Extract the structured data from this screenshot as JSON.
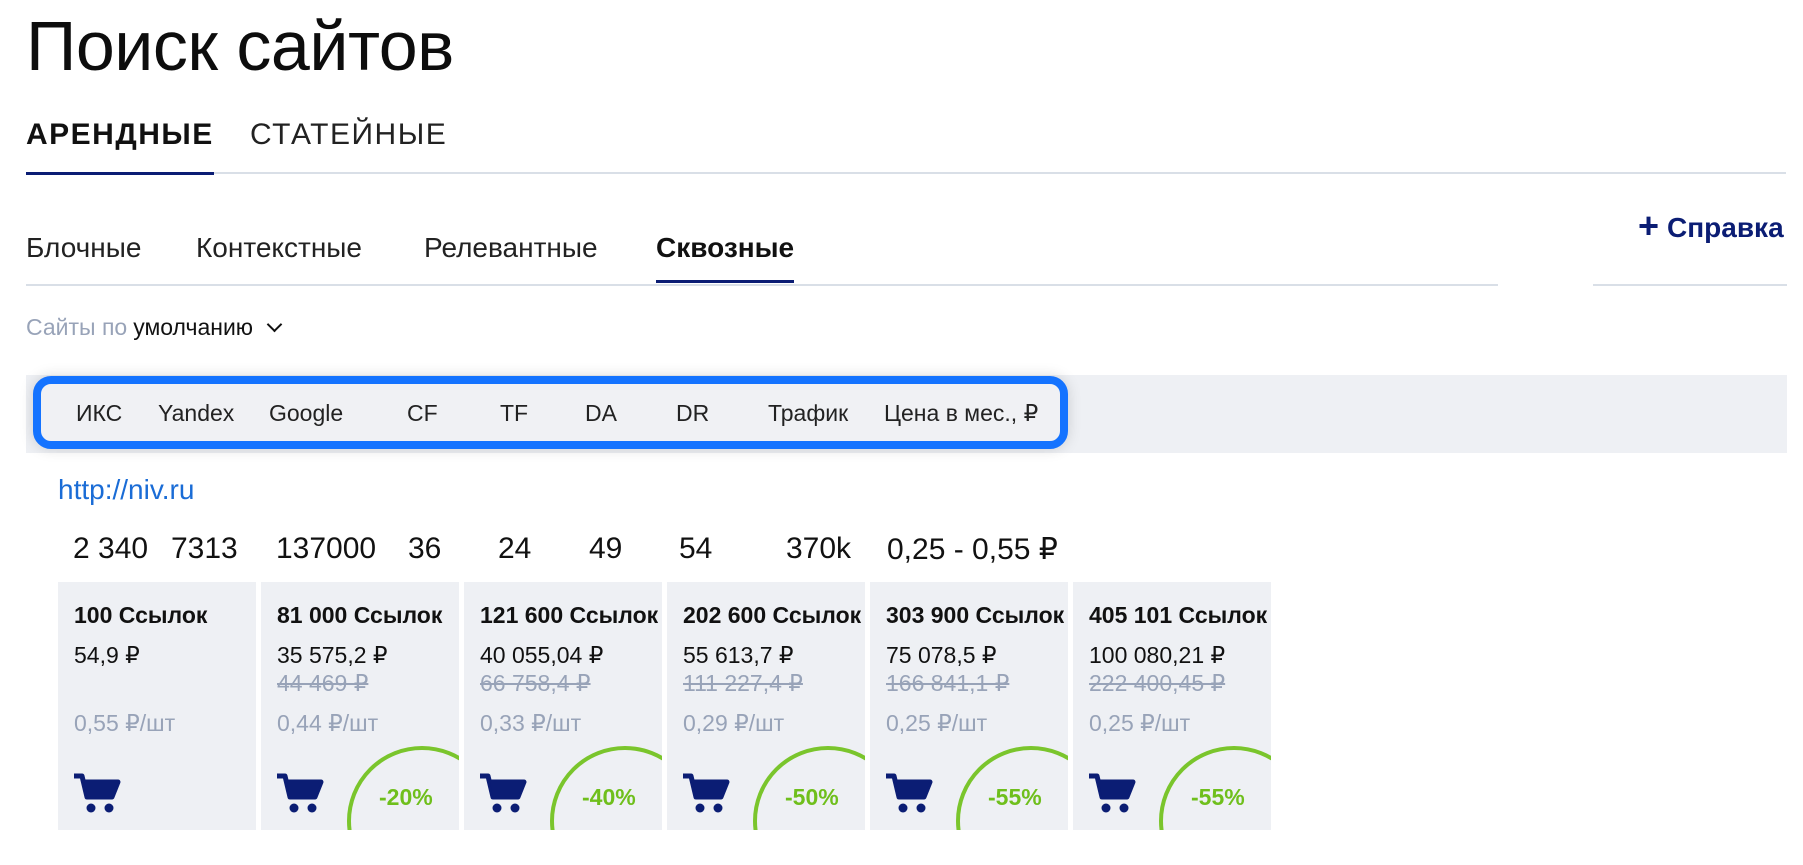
{
  "page": {
    "title": "Поиск сайтов"
  },
  "main_tabs": [
    {
      "label": "АРЕНДНЫЕ",
      "active": true
    },
    {
      "label": "СТАТЕЙНЫЕ",
      "active": false
    }
  ],
  "sub_tabs": [
    {
      "label": "Блочные",
      "active": false
    },
    {
      "label": "Контекстные",
      "active": false
    },
    {
      "label": "Релевантные",
      "active": false
    },
    {
      "label": "Сквозные",
      "active": true
    }
  ],
  "help": {
    "icon": "plus-icon",
    "label": "Справка"
  },
  "sort": {
    "prefix": "Сайты по",
    "value": "умолчанию",
    "icon": "chevron-down-icon"
  },
  "columns": [
    "ИКС",
    "Yandex",
    "Google",
    "CF",
    "TF",
    "DA",
    "DR",
    "Трафик",
    "Цена в мес., ₽"
  ],
  "site": {
    "url": "http://niv.ru",
    "metrics": [
      "2 340",
      "7313",
      "137000",
      "36",
      "24",
      "49",
      "54",
      "370k",
      "0,25 - 0,55 ₽"
    ]
  },
  "offers": [
    {
      "links": "100 Ссылок",
      "price": "54,9 ₽",
      "old_price": "",
      "unit_price": "0,55 ₽/шт",
      "discount": ""
    },
    {
      "links": "81 000 Ссылок",
      "price": "35 575,2 ₽",
      "old_price": "44 469 ₽",
      "unit_price": "0,44 ₽/шт",
      "discount": "-20%"
    },
    {
      "links": "121 600 Ссылок",
      "price": "40 055,04 ₽",
      "old_price": "66 758,4 ₽",
      "unit_price": "0,33 ₽/шт",
      "discount": "-40%"
    },
    {
      "links": "202 600 Ссылок",
      "price": "55 613,7 ₽",
      "old_price": "111 227,4 ₽",
      "unit_price": "0,29 ₽/шт",
      "discount": "-50%"
    },
    {
      "links": "303 900 Ссылок",
      "price": "75 078,5 ₽",
      "old_price": "166 841,1 ₽",
      "unit_price": "0,25 ₽/шт",
      "discount": "-55%"
    },
    {
      "links": "405 101 Ссылок",
      "price": "100 080,21 ₽",
      "old_price": "222 400,45 ₽",
      "unit_price": "0,25 ₽/шт",
      "discount": "-55%"
    }
  ],
  "colors": {
    "accent": "#0b1d74",
    "link": "#1a6cd6",
    "highlight": "#1473ff",
    "discount": "#7ac52c",
    "muted": "#98a3b8",
    "band": "#eef0f4"
  }
}
